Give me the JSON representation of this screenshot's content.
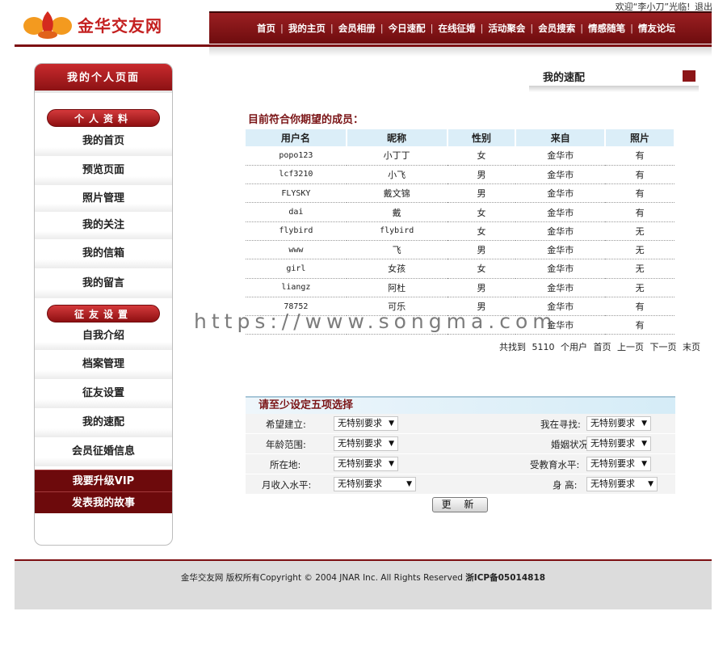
{
  "header": {
    "welcome_prefix": "欢迎“",
    "username": "李小刀",
    "welcome_suffix": "”光临!",
    "logout": "退出",
    "logo_text": "金华交友网",
    "nav": [
      "首页",
      "我的主页",
      "会员相册",
      "今日速配",
      "在线征婚",
      "活动聚会",
      "会员搜索",
      "情感随笔",
      "情友论坛"
    ]
  },
  "sidebar": {
    "title": "我的个人页面",
    "section1": "个人资料",
    "items1": [
      "我的首页",
      "预览页面",
      "照片管理",
      "我的关注",
      "我的信箱",
      "我的留言"
    ],
    "section2": "征友设置",
    "items2": [
      "自我介绍",
      "档案管理",
      "征友设置",
      "我的速配",
      "会员征婚信息"
    ],
    "buttons": [
      "我要升级VIP",
      "发表我的故事"
    ]
  },
  "main": {
    "section_title": "我的速配",
    "subtitle": "目前符合你期望的成员：",
    "columns": [
      "用户名",
      "昵称",
      "性别",
      "来自",
      "照片"
    ],
    "rows": [
      [
        "popo123",
        "小丁丁",
        "女",
        "金华市",
        "有"
      ],
      [
        "lcf3210",
        "小飞",
        "男",
        "金华市",
        "有"
      ],
      [
        "FLYSKY",
        "戴文锦",
        "男",
        "金华市",
        "有"
      ],
      [
        "dai",
        "戴",
        "女",
        "金华市",
        "有"
      ],
      [
        "flybird",
        "flybird",
        "女",
        "金华市",
        "无"
      ],
      [
        "www",
        "飞",
        "男",
        "金华市",
        "无"
      ],
      [
        "girl",
        "女孩",
        "女",
        "金华市",
        "无"
      ],
      [
        "liangz",
        "阿杜",
        "男",
        "金华市",
        "无"
      ],
      [
        "78752",
        "可乐",
        "男",
        "金华市",
        "有"
      ],
      [
        "",
        "",
        "",
        "金华市",
        "有"
      ]
    ],
    "pager": {
      "found_prefix": "共找到",
      "count": "5110",
      "found_suffix": "个用户",
      "first": "首页",
      "prev": "上一页",
      "next": "下一页",
      "last": "末页"
    },
    "watermark": "https://www.songma.com"
  },
  "form": {
    "title": "请至少设定五项选择",
    "rows": [
      {
        "left_label": "希望建立:",
        "left_value": "无特别要求",
        "right_label": "我在寻找:",
        "right_value": "无特别要求"
      },
      {
        "left_label": "年龄范围:",
        "left_value": "无特别要求",
        "right_label": "婚姻状况:",
        "right_value": "无特别要求"
      },
      {
        "left_label": "所在地:",
        "left_value": "无特别要求",
        "right_label": "受教育水平:",
        "right_value": "无特别要求"
      },
      {
        "left_label": "月收入水平:",
        "left_value": "无特别要求",
        "right_label": "身 高:",
        "right_value": "无特别要求"
      }
    ],
    "update_button": "更 新"
  },
  "footer": {
    "text": "金华交友网 版权所有Copyright © 2004 JNAR Inc. All Rights Reserved",
    "icp": "浙ICP备05014818"
  }
}
